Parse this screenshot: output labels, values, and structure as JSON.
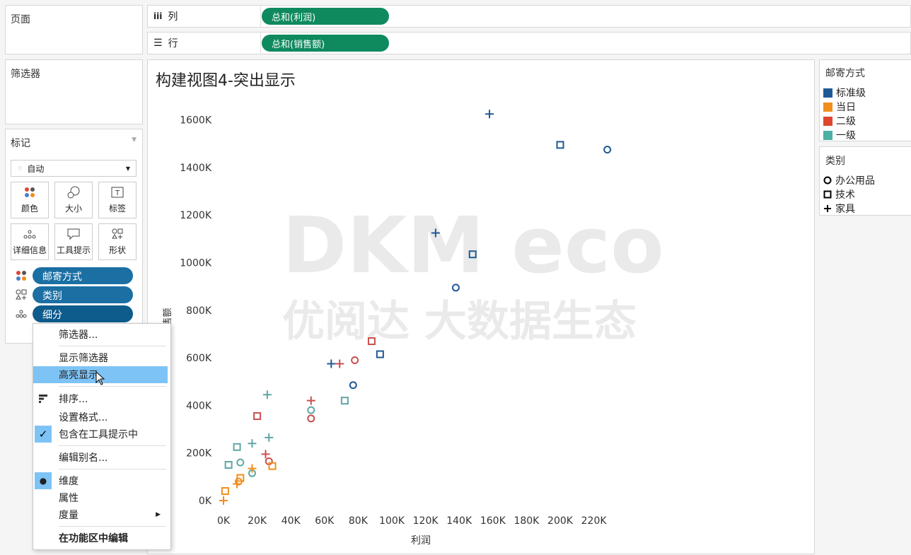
{
  "pages_panel": {
    "title": "页面"
  },
  "filters_panel": {
    "title": "筛选器"
  },
  "marks_panel": {
    "title": "标记",
    "mark_type": "自动",
    "buttons": [
      {
        "label": "颜色",
        "icon": "color-icon"
      },
      {
        "label": "大小",
        "icon": "size-icon"
      },
      {
        "label": "标签",
        "icon": "label-icon"
      },
      {
        "label": "详细信息",
        "icon": "detail-icon"
      },
      {
        "label": "工具提示",
        "icon": "tooltip-icon"
      },
      {
        "label": "形状",
        "icon": "shape-icon"
      }
    ],
    "fields": [
      {
        "label": "邮寄方式",
        "icon": "color-icon"
      },
      {
        "label": "类别",
        "icon": "shape-icon"
      },
      {
        "label": "细分",
        "icon": "detail-icon"
      }
    ]
  },
  "shelves": {
    "columns": {
      "label": "列",
      "pill": "总和(利润)"
    },
    "rows": {
      "label": "行",
      "pill": "总和(销售额)"
    }
  },
  "context_menu": {
    "items": [
      {
        "label": "筛选器..."
      },
      {
        "label": "显示筛选器"
      },
      {
        "label": "高亮显示",
        "highlighted": true
      },
      {
        "label": "排序..."
      },
      {
        "label": "设置格式..."
      },
      {
        "label": "包含在工具提示中",
        "checked": true
      },
      {
        "label": "编辑别名..."
      },
      {
        "label": "维度",
        "selected": true
      },
      {
        "label": "属性"
      },
      {
        "label": "度量"
      },
      {
        "label": "在功能区中编辑"
      }
    ]
  },
  "legend_ship": {
    "title": "邮寄方式",
    "items": [
      {
        "label": "标准级",
        "color": "#1f5a96"
      },
      {
        "label": "当日",
        "color": "#f28e1c"
      },
      {
        "label": "二级",
        "color": "#e0462f"
      },
      {
        "label": "一级",
        "color": "#4bb0a6"
      }
    ]
  },
  "legend_category": {
    "title": "类别",
    "items": [
      {
        "label": "办公用品",
        "shape": "circle"
      },
      {
        "label": "技术",
        "shape": "square"
      },
      {
        "label": "家具",
        "shape": "plus"
      }
    ]
  },
  "watermark": {
    "line1": "DKM eco",
    "line2": "优阅达 大数据生态"
  },
  "chart_data": {
    "type": "scatter",
    "title": "构建视图4-突出显示",
    "xlabel": "利润",
    "ylabel": "销售额",
    "xlim": [
      0,
      240000
    ],
    "ylim": [
      0,
      1700000
    ],
    "x_ticks": [
      "0K",
      "20K",
      "40K",
      "60K",
      "80K",
      "100K",
      "120K",
      "140K",
      "160K",
      "180K",
      "200K",
      "220K"
    ],
    "y_ticks": [
      "0K",
      "200K",
      "400K",
      "600K",
      "800K",
      "1000K",
      "1200K",
      "1400K",
      "1600K"
    ],
    "series_colors": {
      "标准级": "#1f5a96",
      "当日": "#f28e1c",
      "二级": "#c8504c",
      "一级": "#5ea7a5"
    },
    "points": [
      {
        "x": 158000,
        "y": 1625000,
        "ship": "标准级",
        "cat": "家具"
      },
      {
        "x": 200000,
        "y": 1495000,
        "ship": "标准级",
        "cat": "技术"
      },
      {
        "x": 228000,
        "y": 1475000,
        "ship": "标准级",
        "cat": "办公用品"
      },
      {
        "x": 126000,
        "y": 1125000,
        "ship": "标准级",
        "cat": "家具"
      },
      {
        "x": 148000,
        "y": 1035000,
        "ship": "标准级",
        "cat": "技术"
      },
      {
        "x": 138000,
        "y": 895000,
        "ship": "标准级",
        "cat": "办公用品"
      },
      {
        "x": 93000,
        "y": 615000,
        "ship": "标准级",
        "cat": "技术"
      },
      {
        "x": 77000,
        "y": 485000,
        "ship": "标准级",
        "cat": "办公用品"
      },
      {
        "x": 64000,
        "y": 575000,
        "ship": "标准级",
        "cat": "家具"
      },
      {
        "x": 88000,
        "y": 670000,
        "ship": "二级",
        "cat": "技术"
      },
      {
        "x": 78000,
        "y": 590000,
        "ship": "二级",
        "cat": "办公用品"
      },
      {
        "x": 69000,
        "y": 575000,
        "ship": "二级",
        "cat": "家具"
      },
      {
        "x": 52000,
        "y": 420000,
        "ship": "二级",
        "cat": "家具"
      },
      {
        "x": 52000,
        "y": 345000,
        "ship": "二级",
        "cat": "办公用品"
      },
      {
        "x": 20000,
        "y": 355000,
        "ship": "二级",
        "cat": "技术"
      },
      {
        "x": 25000,
        "y": 195000,
        "ship": "二级",
        "cat": "家具"
      },
      {
        "x": 27000,
        "y": 165000,
        "ship": "二级",
        "cat": "办公用品"
      },
      {
        "x": 26000,
        "y": 445000,
        "ship": "一级",
        "cat": "家具"
      },
      {
        "x": 52000,
        "y": 380000,
        "ship": "一级",
        "cat": "办公用品"
      },
      {
        "x": 72000,
        "y": 420000,
        "ship": "一级",
        "cat": "技术"
      },
      {
        "x": 27000,
        "y": 265000,
        "ship": "一级",
        "cat": "家具"
      },
      {
        "x": 17000,
        "y": 240000,
        "ship": "一级",
        "cat": "家具"
      },
      {
        "x": 8000,
        "y": 225000,
        "ship": "一级",
        "cat": "技术"
      },
      {
        "x": 10000,
        "y": 160000,
        "ship": "一级",
        "cat": "办公用品"
      },
      {
        "x": 3000,
        "y": 150000,
        "ship": "一级",
        "cat": "技术"
      },
      {
        "x": 17000,
        "y": 115000,
        "ship": "一级",
        "cat": "办公用品"
      },
      {
        "x": 29000,
        "y": 145000,
        "ship": "当日",
        "cat": "技术"
      },
      {
        "x": 17000,
        "y": 135000,
        "ship": "当日",
        "cat": "家具"
      },
      {
        "x": 10000,
        "y": 95000,
        "ship": "当日",
        "cat": "技术"
      },
      {
        "x": 9000,
        "y": 80000,
        "ship": "当日",
        "cat": "办公用品"
      },
      {
        "x": 8000,
        "y": 70000,
        "ship": "当日",
        "cat": "家具"
      },
      {
        "x": 1000,
        "y": 40000,
        "ship": "当日",
        "cat": "技术"
      },
      {
        "x": 0,
        "y": 0,
        "ship": "当日",
        "cat": "家具"
      }
    ]
  }
}
